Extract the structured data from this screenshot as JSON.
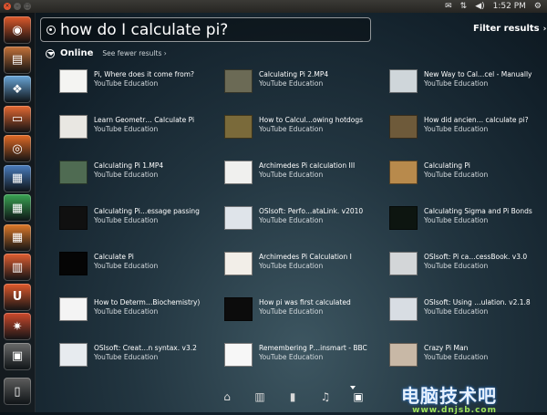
{
  "top_panel": {
    "time": "1:52 PM",
    "icons": [
      "envelope-icon",
      "network-icon",
      "volume-icon",
      "gear-icon"
    ]
  },
  "launcher": {
    "items": [
      {
        "name": "ubuntu-logo-icon",
        "color": "#e05a2b",
        "glyph": "◉"
      },
      {
        "name": "disk-icon",
        "color": "#c6733a",
        "glyph": "▤"
      },
      {
        "name": "windows-icon",
        "color": "#6aa7d9",
        "glyph": "❖"
      },
      {
        "name": "folder-icon",
        "color": "#e86a33",
        "glyph": "▭"
      },
      {
        "name": "firefox-icon",
        "color": "#e36b26",
        "glyph": "◎"
      },
      {
        "name": "writer-icon",
        "color": "#4a7dbf",
        "glyph": "▦"
      },
      {
        "name": "calc-icon",
        "color": "#3aa553",
        "glyph": "▦"
      },
      {
        "name": "impress-icon",
        "color": "#e07a2a",
        "glyph": "▦"
      },
      {
        "name": "software-center-icon",
        "color": "#e35f32",
        "glyph": "▥"
      },
      {
        "name": "ubuntu-one-icon",
        "color": "#e25a2c",
        "glyph": "U"
      },
      {
        "name": "settings-icon",
        "color": "#cf4a2c",
        "glyph": "✷"
      },
      {
        "name": "workspace-icon",
        "color": "#6b6b6b",
        "glyph": "▣"
      },
      {
        "name": "trash-icon",
        "color": "#5e5e5e",
        "glyph": "▯"
      }
    ]
  },
  "search": {
    "query": "how do I calculate pi?"
  },
  "filter_label": "Filter results",
  "section": {
    "title": "Online",
    "toggle": "See fewer results"
  },
  "results": [
    {
      "title": "Pi, Where does it come from?",
      "source": "YouTube Education",
      "thumb": "#f4f4f2"
    },
    {
      "title": "Calculating Pi 2.MP4",
      "source": "YouTube Education",
      "thumb": "#6b6a55"
    },
    {
      "title": "New Way to Cal…cel - Manually",
      "source": "YouTube Education",
      "thumb": "#cfd6da"
    },
    {
      "title": "Learn Geometr… Calculate Pi",
      "source": "YouTube Education",
      "thumb": "#e9e7e2"
    },
    {
      "title": "How to Calcul…owing hotdogs",
      "source": "YouTube Education",
      "thumb": "#7a6a3a"
    },
    {
      "title": "How did ancien… calculate pi?",
      "source": "YouTube Education",
      "thumb": "#6e5a3a"
    },
    {
      "title": "Calculating Pi 1.MP4",
      "source": "YouTube Education",
      "thumb": "#4f6b52"
    },
    {
      "title": "Archimedes Pi calculation III",
      "source": "YouTube Education",
      "thumb": "#f0f0ee"
    },
    {
      "title": "Calculating Pi",
      "source": "YouTube Education",
      "thumb": "#b88a4c"
    },
    {
      "title": "Calculating Pi…essage passing",
      "source": "YouTube Education",
      "thumb": "#101010"
    },
    {
      "title": "OSIsoft: Perfo…ataLink. v2010",
      "source": "YouTube Education",
      "thumb": "#dfe4ea"
    },
    {
      "title": "Calculating Sigma and Pi Bonds",
      "source": "YouTube Education",
      "thumb": "#0d1510"
    },
    {
      "title": "Calculate Pi",
      "source": "YouTube Education",
      "thumb": "#050505"
    },
    {
      "title": "Archimedes Pi Calculation I",
      "source": "YouTube Education",
      "thumb": "#f2eee8"
    },
    {
      "title": "OSIsoft: Pi ca…cessBook. v3.0",
      "source": "YouTube Education",
      "thumb": "#d3d6d8"
    },
    {
      "title": "How to Determ…Biochemistry)",
      "source": "YouTube Education",
      "thumb": "#f4f4f4"
    },
    {
      "title": "How pi was first calculated",
      "source": "YouTube Education",
      "thumb": "#0c0c0c"
    },
    {
      "title": "OSIsoft: Using …ulation. v2.1.8",
      "source": "YouTube Education",
      "thumb": "#d8dde3"
    },
    {
      "title": "OSIsoft: Creat…n syntax. v3.2",
      "source": "YouTube Education",
      "thumb": "#e7ebef"
    },
    {
      "title": "Remembering P…insmart - BBC",
      "source": "YouTube Education",
      "thumb": "#f7f7f7"
    },
    {
      "title": "Crazy Pi Man",
      "source": "YouTube Education",
      "thumb": "#c8b8a6"
    }
  ],
  "lenses": [
    {
      "name": "home-lens-icon",
      "glyph": "⌂"
    },
    {
      "name": "applications-lens-icon",
      "glyph": "▥"
    },
    {
      "name": "files-lens-icon",
      "glyph": "▮"
    },
    {
      "name": "music-lens-icon",
      "glyph": "♫"
    },
    {
      "name": "video-lens-icon",
      "glyph": "▣"
    }
  ],
  "watermark": {
    "top": "电脑技术吧",
    "bottom": "www.dnjsb.com"
  }
}
